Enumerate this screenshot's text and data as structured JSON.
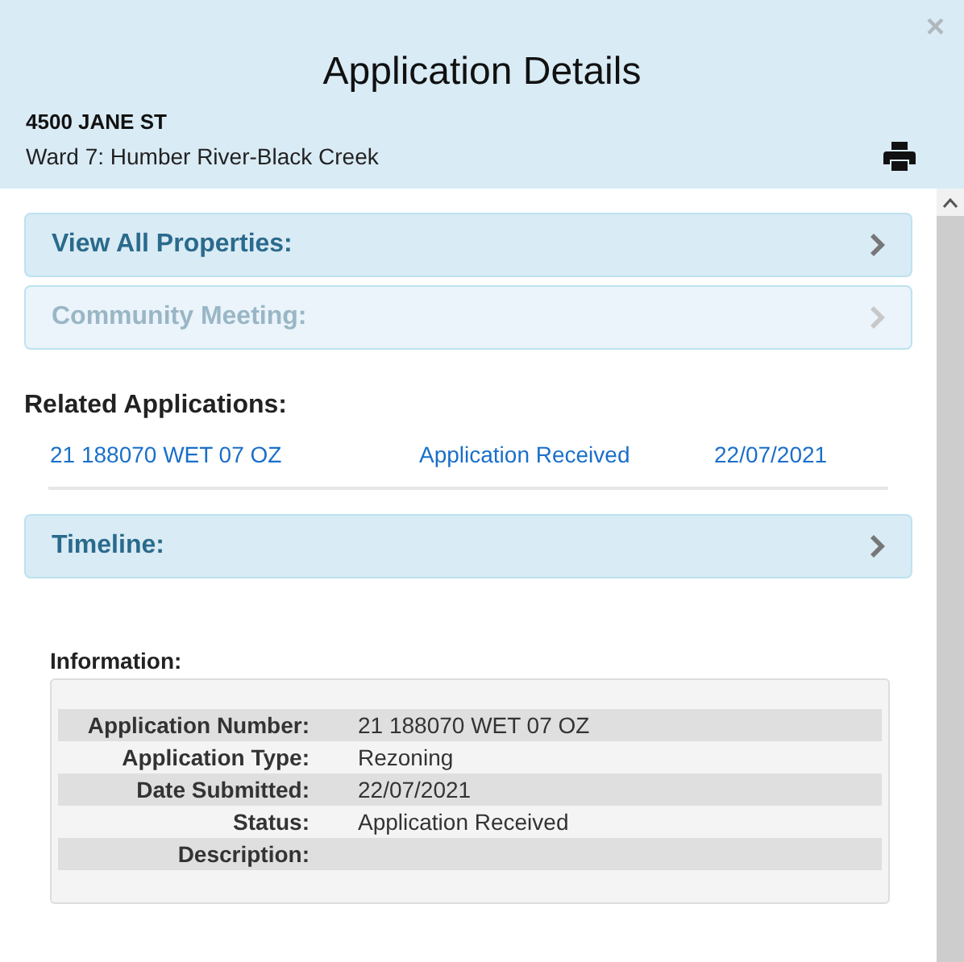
{
  "header": {
    "title": "Application Details",
    "address": "4500 JANE ST",
    "ward": "Ward 7: Humber River-Black Creek",
    "close": "×"
  },
  "panels_top": [
    {
      "label": "View All Properties:",
      "disabled": false
    },
    {
      "label": "Community Meeting:",
      "disabled": true
    }
  ],
  "related": {
    "heading": "Related Applications:",
    "rows": [
      {
        "number": "21 188070 WET 07 OZ",
        "status": "Application Received",
        "date": "22/07/2021"
      }
    ]
  },
  "panels_bottom": [
    {
      "label": "Timeline:",
      "disabled": false
    }
  ],
  "information": {
    "heading": "Information:",
    "rows": [
      {
        "label": "Application Number:",
        "value": "21 188070 WET 07 OZ"
      },
      {
        "label": "Application Type:",
        "value": "Rezoning"
      },
      {
        "label": "Date Submitted:",
        "value": "22/07/2021"
      },
      {
        "label": "Status:",
        "value": "Application Received"
      },
      {
        "label": "Description:"
      }
    ]
  }
}
